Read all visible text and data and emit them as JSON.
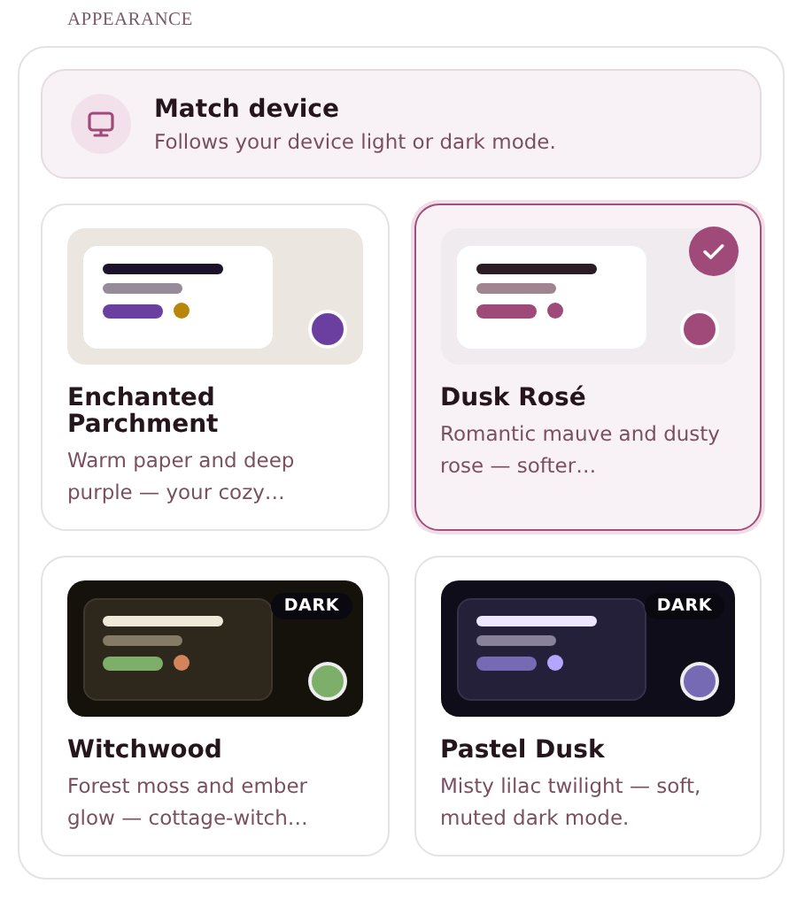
{
  "section_title": "APPEARANCE",
  "match_device": {
    "title": "Match device",
    "description": "Follows your device light or dark mode.",
    "selected": false
  },
  "themes": [
    {
      "name": "Enchanted Parchment",
      "description": "Warm paper and deep purple — your cozy…",
      "selected": false,
      "color": "#6b3fa0"
    },
    {
      "name": "Dusk Rosé",
      "description": "Romantic mauve and dusty rose — softer…",
      "selected": true,
      "color": "#a04a7a"
    },
    {
      "name": "Witchwood",
      "description": "Forest moss and ember glow — cottage-witch…",
      "selected": false,
      "badge": "DARK",
      "color": "#7daf6a"
    },
    {
      "name": "Pastel Dusk",
      "description": "Misty lilac twilight — soft, muted dark mode.",
      "selected": false,
      "badge": "DARK",
      "color": "#766ab5"
    }
  ]
}
